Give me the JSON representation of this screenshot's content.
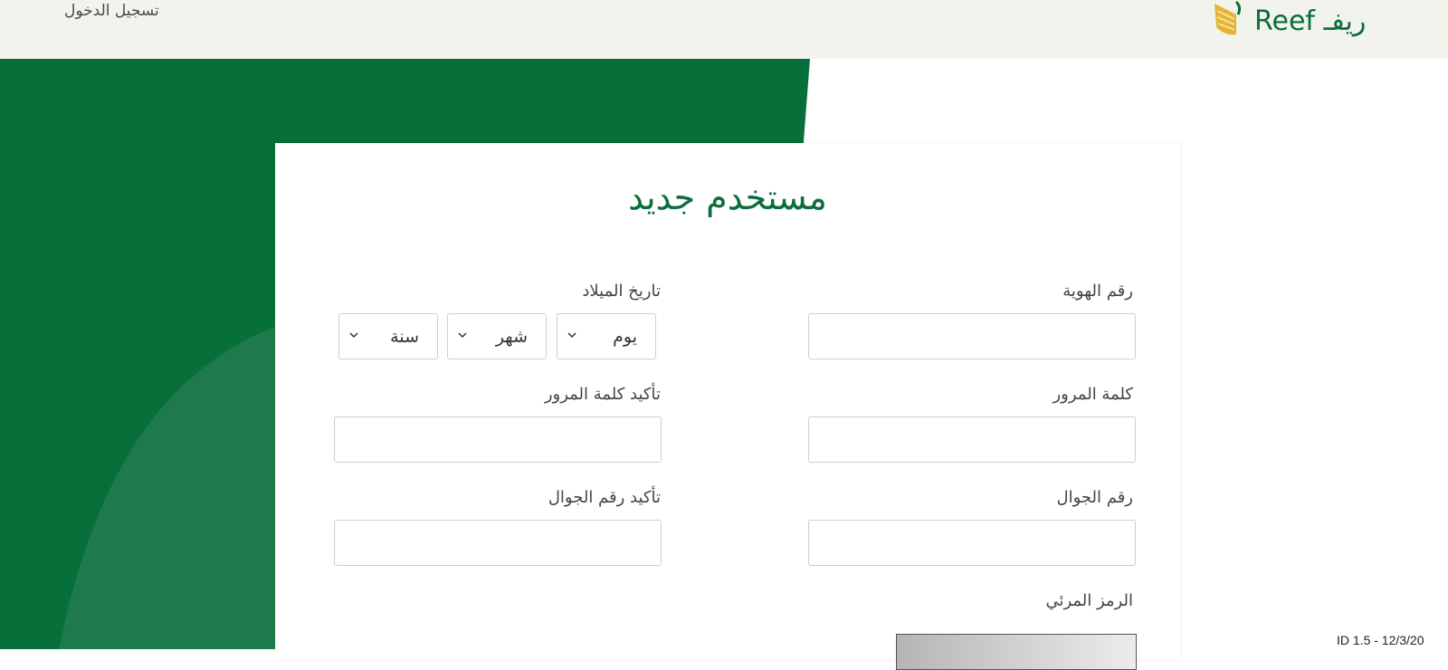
{
  "header": {
    "login_link": "تسجيل الدخول",
    "logo_text": "Reef ريفـ"
  },
  "form": {
    "title": "مستخدم جديد",
    "id_label": "رقم الهوية",
    "id_value": "",
    "dob_label": "تاريخ الميلاد",
    "dob_day": "يوم",
    "dob_month": "شهر",
    "dob_year": "سنة",
    "password_label": "كلمة المرور",
    "password_value": "",
    "confirm_password_label": "تأكيد كلمة المرور",
    "confirm_password_value": "",
    "mobile_label": "رقم الجوال",
    "mobile_value": "",
    "confirm_mobile_label": "تأكيد رقم الجوال",
    "confirm_mobile_value": "",
    "captcha_label": "الرمز المرئي"
  },
  "footer": {
    "version": "ID 1.5 - 12/3/20"
  },
  "colors": {
    "brand_green": "#0a6e3a",
    "brand_gold": "#e5b434",
    "header_bg": "#f3f3ee"
  }
}
